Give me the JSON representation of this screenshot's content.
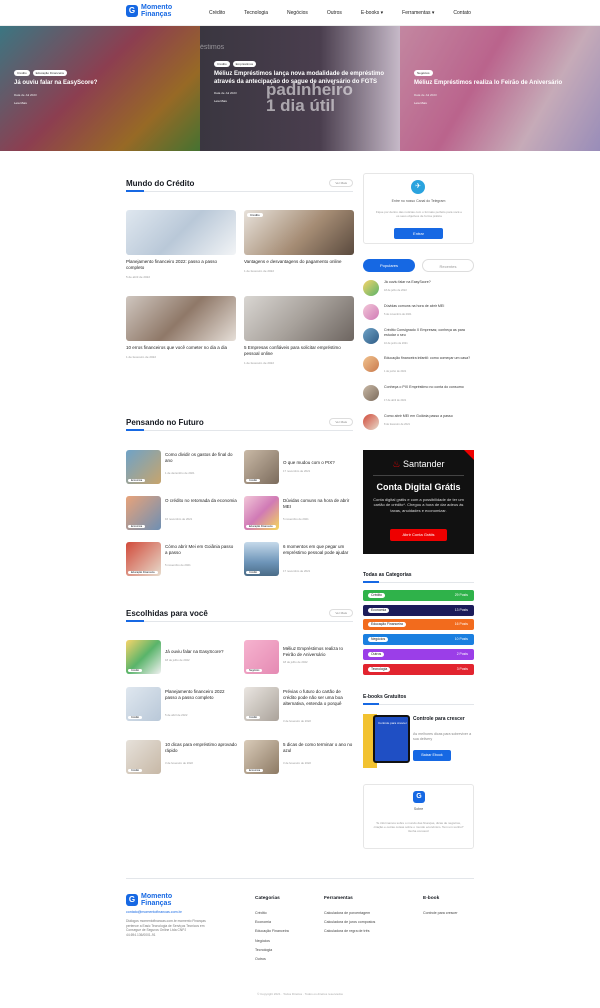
{
  "header": {
    "logo_mark": "G",
    "logo_text": "Momento Finanças",
    "nav": [
      "Crédito",
      "Tecnologia",
      "Negócios",
      "Outros",
      "E-books ▾",
      "Ferramentas ▾",
      "Contato"
    ]
  },
  "hero": {
    "slides": [
      {
        "tags": [
          "Crédito",
          "Educação Financeira"
        ],
        "title": "Já ouviu falar na EasyScore?",
        "meta": "Data de Jul 2023",
        "link": "Leia Mais"
      },
      {
        "tags": [
          "Crédito",
          "Empréstimos"
        ],
        "title": "Méliuz Empréstimos lança nova modalidade de empréstimo através da antecipação do saque de aniversário do FGTS",
        "meta": "Data de Jul 2023",
        "link": "Leia Mais",
        "bg_small": "éstimos",
        "bg_big": "padinheiro\n1 dia útil"
      },
      {
        "tags": [
          "Negócios"
        ],
        "title": "Méliuz Empréstimos realiza Io Feirão de Aniversário",
        "meta": "Data de Jul 2023",
        "link": "Leia Mais"
      }
    ]
  },
  "mundo": {
    "heading": "Mundo do Crédito",
    "ver_mais": "Ver Mais",
    "cards": [
      {
        "title": "Planejamento financeiro 2022: passo a passo completo",
        "date": "5 de abril de 2022"
      },
      {
        "tag": "Crédito",
        "title": "Vantagens e desvantagens do pagamento online",
        "date": "1 de fevereiro de 2022"
      },
      {
        "title": "10 erros financeiros que você cometer no dia a dia",
        "date": "1 de fevereiro de 2022"
      },
      {
        "title": "5 Empresas confiáveis para solicitar empréstimo pessoal online",
        "date": "1 de fevereiro de 2022"
      }
    ]
  },
  "futuro": {
    "heading": "Pensando no Futuro",
    "ver_mais": "Ver Mais",
    "items": [
      {
        "tag": "Economia",
        "title": "Como dividir os gastos de final do ano",
        "date": "1 de dezembro de 2021"
      },
      {
        "tag": "Crédito",
        "title": "O que mudou com o PIX?",
        "date": "17 novembro de 2021"
      },
      {
        "tag": "Economia",
        "title": "O crédito no retomada da economia",
        "date": "16 novembro de 2021"
      },
      {
        "tag": "Educação Financeira",
        "title": "Dúvidas comuns na hora de abrir MEI",
        "date": "5 novembro de 2021"
      },
      {
        "tag": "Educação Financeira",
        "title": "Cómo abrir Mei em Goiânia passo a passo",
        "date": "5 novembro de 2021"
      },
      {
        "tag": "Crédito",
        "title": "6 momentos em que pegar um empréstimo pessoal pode ajudar",
        "date": "17 novembro de 2021"
      }
    ]
  },
  "escolhidas": {
    "heading": "Escolhidas para você",
    "ver_mais": "Ver Mais",
    "items": [
      {
        "tag": "Crédito",
        "title": "Já ouviu falar na EasyScore?",
        "date": "18 de julho de 2022"
      },
      {
        "tag": "Negócios",
        "title": "Méliuz Empréstimos realiza Io Feirão de Aniversário",
        "date": "18 de julho de 2022"
      },
      {
        "tag": "Crédito",
        "title": "Planejamento financeiro 2022 passo a passo completo",
        "date": "5 de abril de 2022"
      },
      {
        "tag": "Crédito",
        "title": "Prévias o futuro do cartão de crédito pode não ser uma boa alternativa, entenda o porquê",
        "date": "3 de fevereiro de 2022"
      },
      {
        "tag": "Crédito",
        "title": "10 dicas para empréstimo aprovado rápido",
        "date": "3 de fevereiro de 2022"
      },
      {
        "tag": "Economia",
        "title": "5 dicas de como terminar o ano no azul",
        "date": "3 de fevereiro de 2022"
      }
    ]
  },
  "telegram": {
    "title": "Entre no nosso Canal do Telegram",
    "desc": "Fique por dentro das notícias com o formato perfeito para você e os seus objetivos de forma prática",
    "button": "Entrar"
  },
  "popular": {
    "tabs": [
      "Populares",
      "Recentes"
    ],
    "items": [
      {
        "title": "Já ouviu falar na EasyScore?",
        "date": "18 de julho de 2022"
      },
      {
        "title": "Dúvidas comuns na hora de abrir MEI",
        "date": "5 de novembro de 2021"
      },
      {
        "title": "Crédito Consignado X Empresas; conheça as para estudar o seu",
        "date": "10 de junho de 2021"
      },
      {
        "title": "Educação financeira infantil: como começar um casa?",
        "date": "1 de junho de 2021"
      },
      {
        "title": "Conheça o PIX Empréstimo no conta do consumo",
        "date": "17 de abril de 2021"
      },
      {
        "title": "Como abrir MEI em Goiânia passo a passo",
        "date": "8 de fevereiro de 2021"
      }
    ]
  },
  "ad": {
    "brand": "Santander",
    "title": "Conta Digital Grátis",
    "desc": "Conta digital grátis e com a possibilidade de ter um cartão de crédito*. Chegou a hora de dar adeus às taxas, anuidades e economizar.",
    "button": "Abrir Conta Grátis"
  },
  "categorias": {
    "heading": "Todas as Categorias",
    "items": [
      {
        "name": "Crédito",
        "count": "29 Posts",
        "color": "#2fb24a"
      },
      {
        "name": "Economia",
        "count": "13 Posts",
        "color": "#1c1c5a"
      },
      {
        "name": "Educação Financeira",
        "count": "16 Posts",
        "color": "#f26b1d"
      },
      {
        "name": "Negócios",
        "count": "10 Posts",
        "color": "#1a7fe0"
      },
      {
        "name": "Outros",
        "count": "2 Posts",
        "color": "#9b3ee8"
      },
      {
        "name": "Tecnologia",
        "count": "3 Posts",
        "color": "#e2242f"
      }
    ]
  },
  "ebooks": {
    "heading": "E-books Gratuitos",
    "screen_text": "Controle para crescer",
    "title": "Controle para crescer",
    "desc": "As melhores dicas para sobreviver a sua delivery",
    "button": "Baixar Ebook"
  },
  "about": {
    "title": "Sobre",
    "desc": "Te informamos sobre o mundo das finanças, dicas de negócios, criação e outras coisas sobre o mundo econômico. Tem um sonho? Venha conosco!"
  },
  "footer": {
    "logo_text": "Momento Finanças",
    "email": "contato@momentofinancas.com.br",
    "desc": "Diálogos momentofinancas.com.br momento Finanças pertence a Easic Tecnologia de Serviços Tecnicos em Consegue de Seguros Online Ltda CNPJ 44.694.136/0001-91",
    "cols": [
      {
        "heading": "Categorias",
        "links": [
          "Crédito",
          "Economia",
          "Educação Financeira",
          "Negócios",
          "Tecnologia",
          "Outros"
        ]
      },
      {
        "heading": "Ferramentas",
        "links": [
          "Calculadora de porcentagem",
          "Calculadora de juros compostos",
          "Calculadora de regra de três"
        ]
      },
      {
        "heading": "E-book",
        "links": [
          "Controle para crescer"
        ]
      }
    ],
    "copyright": "© Copyright 2021 · Todos Direitos · Todos os direitos reservados"
  }
}
